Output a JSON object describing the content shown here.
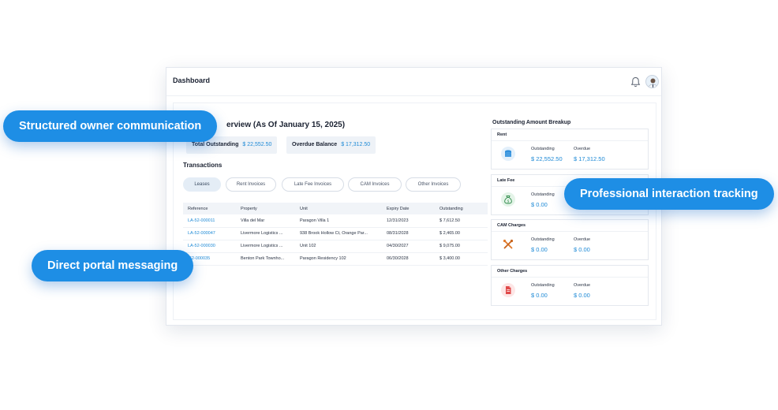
{
  "header": {
    "title": "Dashboard"
  },
  "overview": {
    "title": "erview (As Of January 15, 2025)",
    "total_outstanding_label": "Total Outstanding",
    "total_outstanding_value": "$ 22,552.50",
    "overdue_balance_label": "Overdue Balance",
    "overdue_balance_value": "$ 17,312.50"
  },
  "transactions": {
    "title": "Transactions",
    "tabs": [
      "Leases",
      "Rent Invoices",
      "Late Fee Invoices",
      "CAM Invoices",
      "Other Invoices"
    ],
    "active_tab": "Leases",
    "columns": [
      "Reference",
      "Property",
      "Unit",
      "Expiry Date",
      "Outstanding"
    ],
    "rows": [
      [
        "LA-52-000011",
        "Villa del Mar",
        "Paragon Villa 1",
        "12/31/2023",
        "$ 7,612.50"
      ],
      [
        "LA-52-000047",
        "Livermore Logistics ...",
        "938 Brook Hollow Ct, Orange Par...",
        "08/31/2028",
        "$ 2,465.00"
      ],
      [
        "LA-52-000030",
        "Livermore Logistics ...",
        "Unit 102",
        "04/30/2027",
        "$ 9,075.00"
      ],
      [
        "-52-000035",
        "Benton Park Townho...",
        "Paragon Residency 102",
        "06/30/2028",
        "$ 3,400.00"
      ]
    ]
  },
  "breakup": {
    "title": "Outstanding Amount Breakup",
    "cards": [
      {
        "name": "Rent",
        "outstanding_label": "Outstanding",
        "outstanding": "$ 22,552.50",
        "overdue_label": "Overdue",
        "overdue": "$ 17,312.50",
        "icon": "coins-icon",
        "icon_color": "#2f8fdc"
      },
      {
        "name": "Late Fee",
        "outstanding_label": "Outstanding",
        "outstanding": "$ 0.00",
        "overdue_label": "",
        "overdue": "",
        "icon": "money-bag-icon",
        "icon_color": "#3aa05a"
      },
      {
        "name": "CAM Charges",
        "outstanding_label": "Outstanding",
        "outstanding": "$ 0.00",
        "overdue_label": "Overdue",
        "overdue": "$ 0.00",
        "icon": "tools-icon",
        "icon_color": "#e07a2c"
      },
      {
        "name": "Other Charges",
        "outstanding_label": "Outstanding",
        "outstanding": "$ 0.00",
        "overdue_label": "Overdue",
        "overdue": "$ 0.00",
        "icon": "document-icon",
        "icon_color": "#e04a4a"
      }
    ]
  },
  "callouts": {
    "structured": "Structured owner communication",
    "professional": "Professional interaction tracking",
    "direct": "Direct portal messaging"
  },
  "colors": {
    "accent": "#1e8ee5",
    "link": "#1e8ad6"
  }
}
